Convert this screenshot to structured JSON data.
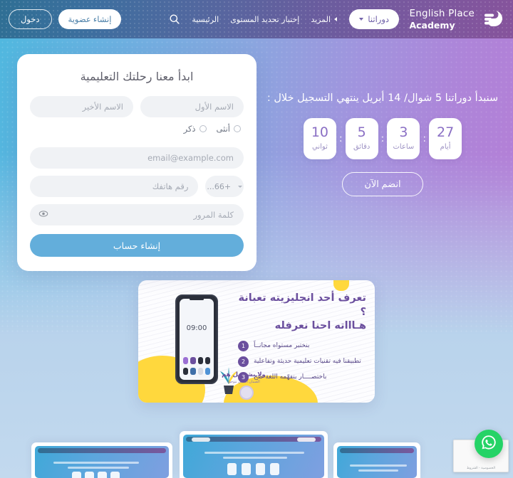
{
  "header": {
    "brand": {
      "line1": "English Place",
      "line2": "Academy",
      "logo_icon": "english-place-monogram"
    },
    "courses_button": {
      "label": "دوراتنا",
      "icon": "chevron-down-icon"
    },
    "search_icon": "search-icon",
    "nav": [
      {
        "label": "الرئيسية",
        "name": "home"
      },
      {
        "label": "إختبار تحديد المستوى",
        "name": "placement-test"
      },
      {
        "label": "المزيد",
        "name": "more",
        "icon": "chevron-left-icon"
      }
    ],
    "auth": {
      "signup": "إنشاء عضوية",
      "login": "دخول"
    }
  },
  "promo": {
    "headline": "سنبدأ دوراتنا 5 شوال/ 14 أبريل ينتهي التسجيل خلال :",
    "countdown": [
      {
        "value": "27",
        "label": "أيام"
      },
      {
        "value": "3",
        "label": "ساعات"
      },
      {
        "value": "5",
        "label": "دقائق"
      },
      {
        "value": "10",
        "label": "ثواني"
      }
    ],
    "separator": ":",
    "join_button": "انضم الآن"
  },
  "signup_form": {
    "title": "ابدأ معنا رحلتك التعليمية",
    "first_name_placeholder": "الاسم الأول",
    "last_name_placeholder": "الاسم الأخير",
    "gender": {
      "male": "ذكر",
      "female": "أنثى"
    },
    "email_placeholder": "email@example.com",
    "country_code": "+66...",
    "phone_placeholder": "رقم هاتفك",
    "password_placeholder": "كلمة المرور",
    "password_toggle_icon": "eye-icon",
    "submit": "إنشاء حساب",
    "submit_color": "#63aedb"
  },
  "banner": {
    "headline_line1": "تعرف أحد انجليزيته تعبانة ؟",
    "headline_line2": "هـاااته احنا نعرفله",
    "items": [
      {
        "num": "1",
        "text": "بنختبر مستواه مجانــاً"
      },
      {
        "num": "2",
        "text": "تطبيقنا فيه تقنيات تعليمية حديثة وتفاعلية"
      },
      {
        "num": "3",
        "text": "باختصــــار بنفهّمه اللغة صح"
      }
    ],
    "phone_time": "09:00",
    "brand_tagline": "ولا يشيـــل هم",
    "brand_sub": "الضمان الذهبي موجود",
    "accent_color": "#6b4f9e",
    "highlight_color": "#ffd83d"
  },
  "floating": {
    "whatsapp_icon": "whatsapp-icon",
    "recaptcha_text": "الخصوصية - الشروط"
  }
}
